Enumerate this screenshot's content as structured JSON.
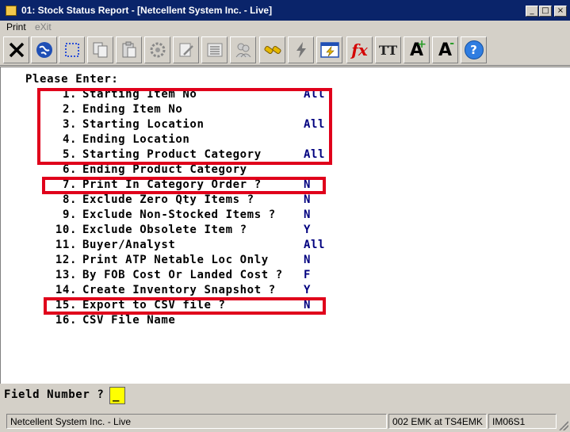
{
  "window": {
    "title": "01: Stock Status Report - [Netcellent System Inc. - Live]",
    "controls": {
      "minimize": "_",
      "maximize": "□",
      "close": "×"
    }
  },
  "menu": {
    "items": [
      {
        "label": "Print",
        "enabled": true
      },
      {
        "label": "eXit",
        "enabled": false
      }
    ]
  },
  "toolbar": {
    "buttons": [
      {
        "icon": "cut-tools-icon"
      },
      {
        "icon": "globe-icon"
      },
      {
        "icon": "select-box-icon"
      },
      {
        "icon": "copy-icon"
      },
      {
        "icon": "paste-icon"
      },
      {
        "icon": "settings-gear-icon"
      },
      {
        "icon": "edit-doc-icon"
      },
      {
        "icon": "list-icon"
      },
      {
        "icon": "users-icon"
      },
      {
        "icon": "link-icon"
      },
      {
        "icon": "lightning-icon"
      },
      {
        "icon": "run-window-icon"
      },
      {
        "icon": "function-icon",
        "label": "fx"
      },
      {
        "icon": "font-size-icon",
        "label": "TT"
      },
      {
        "icon": "font-increase-icon",
        "label": "A"
      },
      {
        "icon": "font-decrease-icon",
        "label": "A"
      },
      {
        "icon": "help-icon",
        "label": "?"
      }
    ]
  },
  "form": {
    "prompt": "Please Enter:",
    "fields": [
      {
        "num": "1.",
        "label": "Starting Item No",
        "value": "All"
      },
      {
        "num": "2.",
        "label": "Ending Item No",
        "value": ""
      },
      {
        "num": "3.",
        "label": "Starting Location",
        "value": "All"
      },
      {
        "num": "4.",
        "label": "Ending Location",
        "value": ""
      },
      {
        "num": "5.",
        "label": "Starting Product Category",
        "value": "All"
      },
      {
        "num": "6.",
        "label": "Ending Product Category",
        "value": ""
      },
      {
        "num": "7.",
        "label": "Print In Category Order ?",
        "value": "N"
      },
      {
        "num": "8.",
        "label": "Exclude Zero Qty Items ?",
        "value": "N"
      },
      {
        "num": "9.",
        "label": "Exclude Non-Stocked Items ?",
        "value": "N"
      },
      {
        "num": "10.",
        "label": "Exclude Obsolete Item ?",
        "value": "Y"
      },
      {
        "num": "11.",
        "label": "Buyer/Analyst",
        "value": "All"
      },
      {
        "num": "12.",
        "label": "Print ATP Netable Loc Only",
        "value": "N"
      },
      {
        "num": "13.",
        "label": "By FOB Cost Or Landed Cost ?",
        "value": "F"
      },
      {
        "num": "14.",
        "label": "Create Inventory Snapshot ?",
        "value": "Y"
      },
      {
        "num": "15.",
        "label": "Export to CSV file ?",
        "value": "N"
      },
      {
        "num": "16.",
        "label": "CSV File Name",
        "value": ""
      }
    ],
    "highlight_color": "#e0001b",
    "value_color": "#00007f"
  },
  "field_number": {
    "label": "Field Number ?",
    "value": "_"
  },
  "status": {
    "company": "Netcellent System Inc. - Live",
    "session": "002 EMK at TS4EMK",
    "program": "IM06S1"
  }
}
